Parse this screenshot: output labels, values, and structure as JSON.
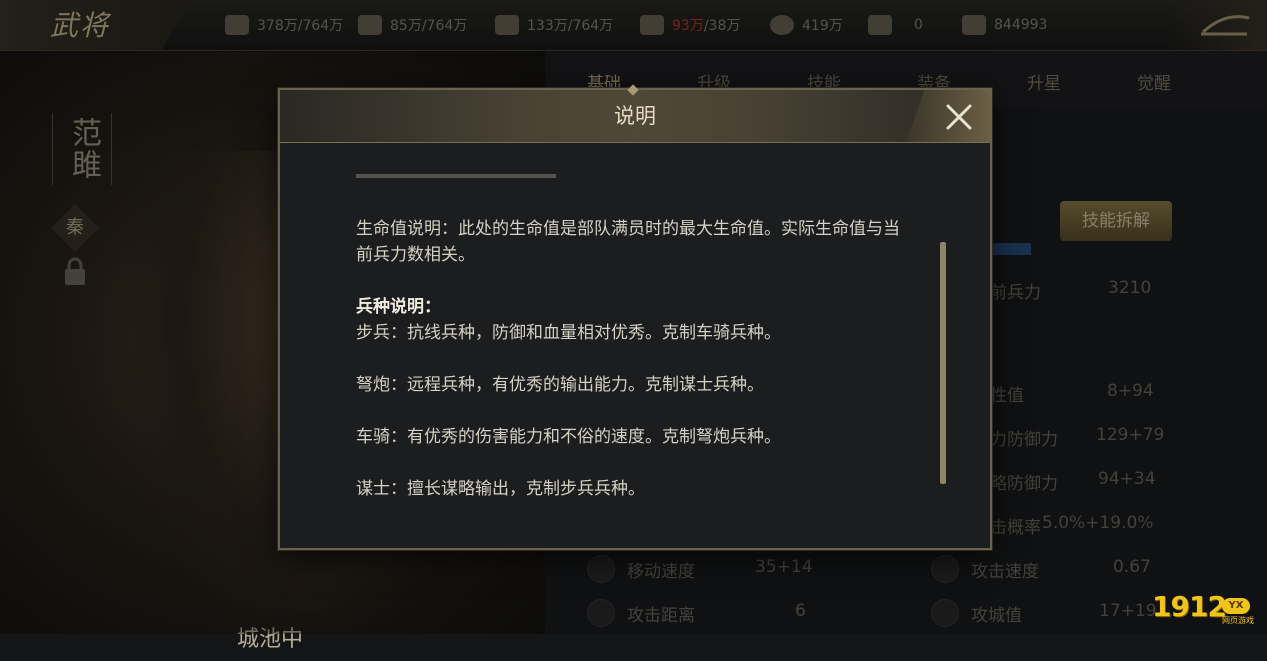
{
  "topbar": {
    "title": "武将",
    "resources": [
      {
        "icon": "wood-icon",
        "value": "378万/764万",
        "warn": false
      },
      {
        "icon": "stone-icon",
        "value": "85万/764万",
        "warn": false
      },
      {
        "icon": "iron-icon",
        "value": "133万/764万",
        "warn": false
      },
      {
        "icon": "food-icon",
        "value_warn": "93万",
        "value_rest": "/38万",
        "warn": true
      },
      {
        "icon": "coin-icon",
        "value": "419万",
        "warn": false
      },
      {
        "icon": "token-icon",
        "value": "0",
        "warn": false
      },
      {
        "icon": "gem-icon",
        "value": "844993",
        "warn": false
      }
    ]
  },
  "hero": {
    "name": "范雎",
    "faction": "秦",
    "location": "城池中"
  },
  "stats": {
    "tabs": [
      "基础",
      "升级",
      "技能",
      "装备",
      "升星",
      "觉醒"
    ],
    "skill_button": "技能拆解",
    "rows": [
      {
        "label": "前兵力",
        "value": "3210"
      },
      {
        "label": "性值",
        "value": "8+94"
      },
      {
        "label": "力防御力",
        "value": "129+79"
      },
      {
        "label": "略防御力",
        "value": "94+34"
      },
      {
        "label": "击概率",
        "value": "5.0%+19.0%"
      }
    ],
    "bottom_rows": [
      {
        "label": "移动速度",
        "value": "35+14"
      },
      {
        "label": "攻击距离",
        "value": "6"
      },
      {
        "label": "攻击速度",
        "value": "0.67"
      },
      {
        "label": "攻城值",
        "value": "17+19"
      }
    ]
  },
  "modal": {
    "title": "说明",
    "paragraphs": [
      {
        "text": "生命值说明：此处的生命值是部队满员时的最大生命值。实际生命值与当前兵力数相关。"
      },
      {
        "heading": "兵种说明：",
        "text": "步兵：抗线兵种，防御和血量相对优秀。克制车骑兵种。"
      },
      {
        "text": "弩炮：远程兵种，有优秀的输出能力。克制谋士兵种。"
      },
      {
        "text": "车骑：有优秀的伤害能力和不俗的速度。克制弩炮兵种。"
      },
      {
        "text": "谋士：擅长谋略输出，克制步兵兵种。"
      }
    ]
  },
  "watermark": {
    "brand": "1912",
    "badge": "YX",
    "sub": "网页游戏"
  },
  "colors": {
    "accent": "#c4b487",
    "warning": "#c0392b",
    "watermark": "#f0c419"
  }
}
